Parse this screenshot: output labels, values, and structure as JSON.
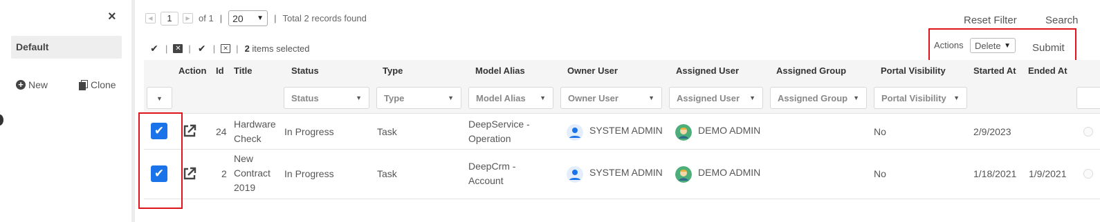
{
  "sidebar": {
    "view_name": "Default",
    "new_label": "New",
    "clone_label": "Clone",
    "close_glyph": "×"
  },
  "pager": {
    "current_page": "1",
    "of_label": "of 1",
    "page_size": "20",
    "total_text": "Total 2 records found"
  },
  "toolbar": {
    "reset_filter_label": "Reset Filter",
    "search_label": "Search",
    "selected_count": "2",
    "selected_suffix": "items selected",
    "actions_label": "Actions",
    "actions_value": "Delete",
    "submit_label": "Submit"
  },
  "columns": {
    "action": "Action",
    "id": "Id",
    "title": "Title",
    "status": "Status",
    "type": "Type",
    "model_alias": "Model Alias",
    "owner_user": "Owner User",
    "assigned_user": "Assigned User",
    "assigned_group": "Assigned Group",
    "portal_visibility": "Portal Visibility",
    "started_at": "Started At",
    "ended_at": "Ended At"
  },
  "filters": {
    "status": "Status",
    "type": "Type",
    "model_alias": "Model Alias",
    "owner_user": "Owner User",
    "assigned_user": "Assigned User",
    "assigned_group": "Assigned Group",
    "portal_visibility": "Portal Visibility"
  },
  "rows": [
    {
      "checked": true,
      "id": "24",
      "title_lines": [
        "Hardware",
        "Check"
      ],
      "status": "In Progress",
      "type": "Task",
      "model_alias_lines": [
        "DeepService -",
        "Operation"
      ],
      "owner_user": "SYSTEM ADMIN",
      "assigned_user": "DEMO ADMIN",
      "assigned_group": "",
      "portal_visibility": "No",
      "started_at": "2/9/2023",
      "ended_at": ""
    },
    {
      "checked": true,
      "id": "2",
      "title_lines": [
        "New",
        "Contract",
        "2019"
      ],
      "status": "In Progress",
      "type": "Task",
      "model_alias_lines": [
        "DeepCrm -",
        "Account"
      ],
      "owner_user": "SYSTEM ADMIN",
      "assigned_user": "DEMO ADMIN",
      "assigned_group": "",
      "portal_visibility": "No",
      "started_at": "1/18/2021",
      "ended_at": "1/9/2021"
    }
  ],
  "icons": {
    "close": "close-icon",
    "new": "plus-circle-icon",
    "clone": "copy-icon",
    "select_all": "double-check-icon",
    "deselect": "close-square-icon",
    "check": "check-icon",
    "clear": "clear-square-icon",
    "external": "external-link-icon",
    "owner_avatar": "user-avatar-icon",
    "assigned_avatar": "person-avatar-icon"
  },
  "colors": {
    "checkbox": "#1a73e8",
    "highlight": "#e0121b",
    "header_bg": "#f5f5f5"
  }
}
